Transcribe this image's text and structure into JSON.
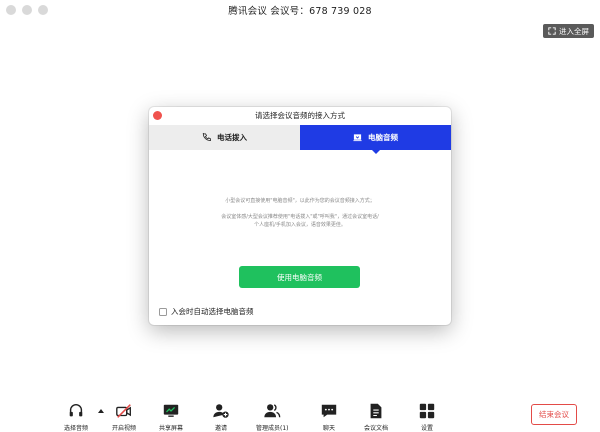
{
  "window": {
    "title": "腾讯会议 会议号：678 739 028"
  },
  "fullscreen": {
    "label": "进入全屏"
  },
  "dialog": {
    "title": "请选择会议音频的接入方式",
    "tabs": [
      {
        "label": "电话拨入",
        "icon": "phone-icon",
        "active": false
      },
      {
        "label": "电脑音频",
        "icon": "computer-audio-icon",
        "active": true
      }
    ],
    "desc_line1": "小型会议可直接使用\"电脑音频\"，以此作为您的会议音频接入方式；",
    "desc_line2": "会议室体感/大型会议推荐使用\"电话拨入\"或\"呼叫我\"，通过会议室电话/个人座机/手机加入会议，语音效果更佳。",
    "use_button": "使用电脑音频",
    "auto_checkbox": {
      "label": "入会时自动选择电脑音频",
      "checked": false
    }
  },
  "toolbar": {
    "items": [
      {
        "label": "选择音频",
        "icon": "headset-icon"
      },
      {
        "label": "开启视频",
        "icon": "video-off-icon"
      },
      {
        "label": "共享屏幕",
        "icon": "share-screen-icon"
      },
      {
        "label": "邀请",
        "icon": "invite-icon"
      },
      {
        "label": "管理成员(1)",
        "icon": "members-icon"
      },
      {
        "label": "聊天",
        "icon": "chat-icon"
      },
      {
        "label": "会议文档",
        "icon": "document-icon"
      },
      {
        "label": "设置",
        "icon": "settings-icon"
      }
    ],
    "end_button": "结束会议"
  },
  "colors": {
    "accent_blue": "#1f3be4",
    "primary_green": "#1fc15e",
    "danger_red": "#e34b48",
    "close_red": "#f0524d"
  }
}
